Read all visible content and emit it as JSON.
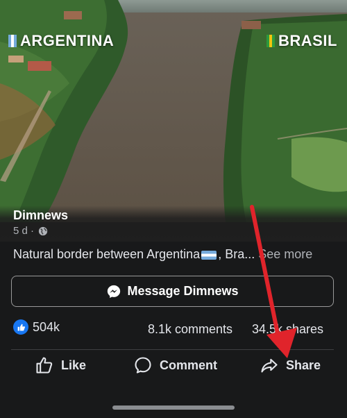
{
  "hero": {
    "left_label": "ARGENTINA",
    "right_label": "BRASIL"
  },
  "post": {
    "page_name": "Dimnews",
    "time": "5 d ·",
    "caption_text": "Natural border between Argentina",
    "caption_tail": ", Bra...",
    "see_more": "See more"
  },
  "message_button": {
    "label": "Message Dimnews"
  },
  "stats": {
    "likes": "504k",
    "comments": "8.1k comments",
    "shares": "34.5k shares"
  },
  "actions": {
    "like": "Like",
    "comment": "Comment",
    "share": "Share"
  },
  "colors": {
    "background": "#18191a",
    "accent_blue": "#1877f2",
    "annotation_red": "#e0242b"
  }
}
